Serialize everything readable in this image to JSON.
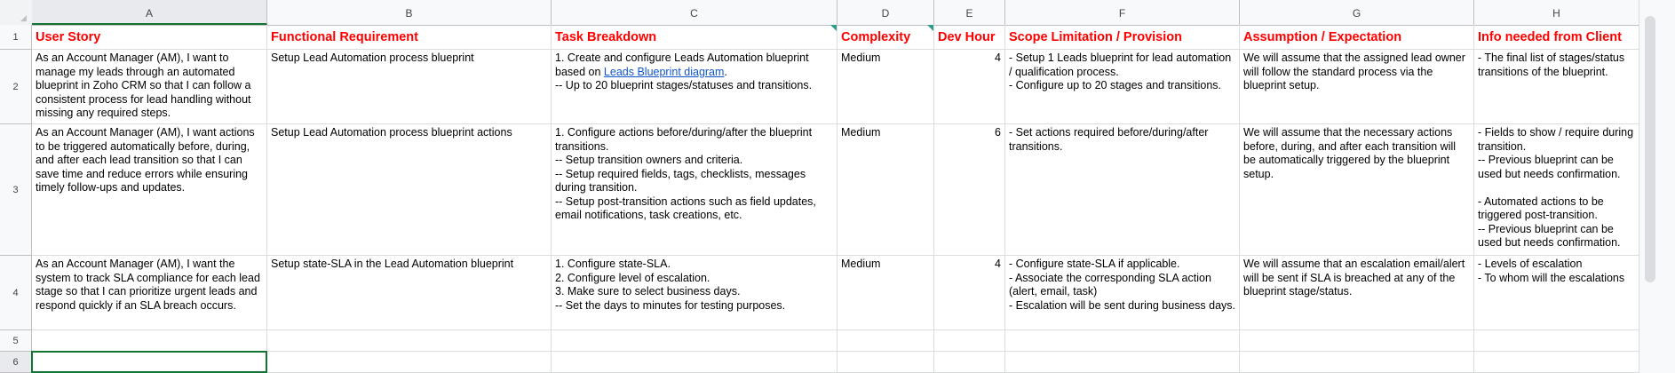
{
  "columns": [
    "A",
    "B",
    "C",
    "D",
    "E",
    "F",
    "G",
    "H"
  ],
  "rows": [
    "1",
    "2",
    "3",
    "4",
    "5",
    "6"
  ],
  "headers": {
    "user_story": "User Story",
    "functional_requirement": "Functional Requirement",
    "task_breakdown": "Task Breakdown",
    "complexity": "Complexity",
    "dev_hour": "Dev Hour",
    "scope": "Scope Limitation  / Provision",
    "assumption": "Assumption / Expectation",
    "info_needed": "Info needed from Client"
  },
  "data_rows": [
    {
      "user_story": "As an Account Manager (AM), I want to manage my leads through an automated blueprint in Zoho CRM so that I can follow a consistent process for lead handling without missing any required steps.",
      "functional_requirement": "Setup Lead Automation process blueprint",
      "task_breakdown_pre": "1. Create and configure Leads Automation blueprint based on ",
      "task_breakdown_link": "Leads Blueprint diagram",
      "task_breakdown_post": ".\n-- Up to 20 blueprint stages/statuses and transitions.",
      "complexity": "Medium",
      "dev_hour": "4",
      "scope": "- Setup 1 Leads blueprint for lead automation / qualification process.\n- Configure up to 20 stages and transitions.",
      "assumption": "We will assume that the assigned lead owner will follow the standard process via the blueprint setup.",
      "info_needed": "- The final list of stages/status transitions of the blueprint."
    },
    {
      "user_story": "As an Account Manager (AM), I want actions to be triggered automatically before, during, and after each lead transition so that I can save time and reduce errors while ensuring timely follow-ups and updates.",
      "functional_requirement": "Setup Lead Automation process blueprint actions",
      "task_breakdown": "1. Configure actions before/during/after the blueprint transitions.\n-- Setup transition owners and criteria.\n-- Setup required fields, tags, checklists, messages during transition.\n-- Setup post-transition actions such as field updates, email notifications, task creations, etc.",
      "complexity": "Medium",
      "dev_hour": "6",
      "scope": "- Set actions required before/during/after transitions.",
      "assumption": "We will assume that the necessary actions before, during, and after each transition will be automatically triggered by the blueprint setup.",
      "info_needed": "- Fields to show / require during transition.\n-- Previous blueprint can be used but needs confirmation.\n\n- Automated actions to be triggered post-transition.\n-- Previous blueprint can be used but needs confirmation."
    },
    {
      "user_story": "As an Account Manager (AM), I want the system to track SLA compliance for each lead stage so that I can prioritize urgent leads and respond quickly if an SLA breach occurs.",
      "functional_requirement": "Setup state-SLA in the Lead Automation blueprint",
      "task_breakdown": "1. Configure state-SLA.\n2. Configure level of escalation.\n3. Make sure to select business days.\n-- Set the days to minutes for testing purposes.",
      "complexity": "Medium",
      "dev_hour": "4",
      "scope": "- Configure state-SLA if applicable.\n- Associate the corresponding SLA action (alert, email, task)\n- Escalation will be sent during business days.",
      "assumption": "We will assume that an escalation email/alert will be sent if SLA is breached at any of the blueprint stage/status.",
      "info_needed": "- Levels of escalation\n- To whom will the escalations"
    }
  ],
  "colors": {
    "header_text": "#ff0000",
    "selection": "#137333",
    "link": "#1155cc",
    "note_marker": "#2f9b8b"
  }
}
